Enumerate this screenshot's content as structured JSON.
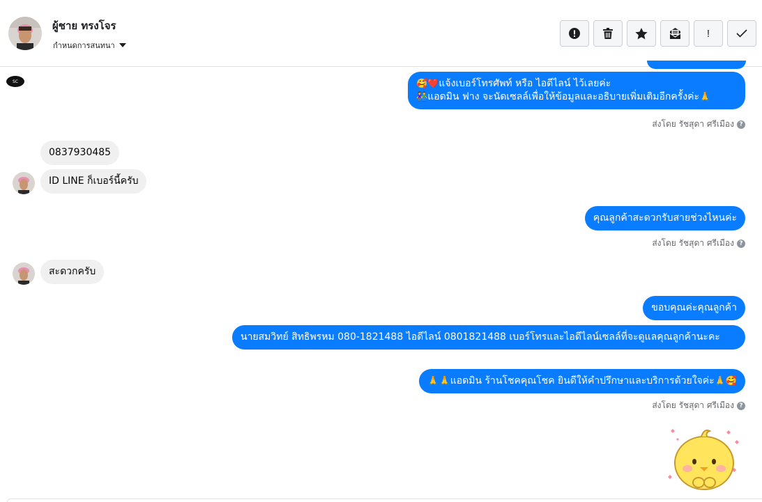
{
  "header": {
    "contact_name": "ผู้ชาย ทรงโจร",
    "assign_label": "กำหนดการสนทนา"
  },
  "toolbar": {
    "buttons": [
      {
        "name": "spam-button",
        "icon": "alert-circle-icon"
      },
      {
        "name": "delete-button",
        "icon": "trash-icon"
      },
      {
        "name": "star-button",
        "icon": "star-icon"
      },
      {
        "name": "mark-unread-button",
        "icon": "envelope-icon"
      },
      {
        "name": "follow-up-button",
        "icon": "exclamation-icon",
        "text": "!"
      },
      {
        "name": "done-button",
        "icon": "check-icon"
      }
    ]
  },
  "messages": {
    "out1": {
      "line1": "แจ้งเบอร์โทรศัพท์ หรือ ไอดีไลน์  ไว้เลยค่ะ",
      "line2": "แอดมิน ฟาง จะนัดเซลล์เพื่อให้ข้อมูลและอธิบายเพิ่มเติมอีกครั้งค่ะ",
      "emoji_start_1": "🥰❤️",
      "emoji_start_2": "👫",
      "emoji_end_2": "🙏"
    },
    "sent_by_1": "ส่งโดย รัชสุดา ศรีเมือง",
    "in1": "0837930485",
    "in2": "ID LINE ก็เบอร์นี้ครับ",
    "out2": "คุณลูกค้าสะดวกรับสายช่วงไหนค่ะ",
    "sent_by_2": "ส่งโดย รัชสุดา ศรีเมือง",
    "in3": "สะดวกครับ",
    "out3": "ขอบคุณค่ะคุณลูกค้า",
    "out4": "นายสมวิทย์ สิทธิพรหม   080-1821488 ไอดีไลน์ 0801821488  เบอร์โทรและไอดีไลน์เซลล์ที่จะดูแลคุณลูกค้านะคะ",
    "out5": "แอดมิน ร้านโชคคุณโชค ยินดีให้คำปรึกษาและบริการด้วยใจค่ะ",
    "out5_emoji_start": "🙏🙏",
    "out5_emoji_end": "🙏🥰",
    "sent_by_3": "ส่งโดย รัชสุดา ศรีเมือง",
    "sticker": "chick-sticker"
  },
  "page_logo_text": "SC",
  "colors": {
    "outgoing_bubble": "#0a7cff",
    "incoming_bubble": "#f0f0f0",
    "muted_text": "#65676b"
  }
}
